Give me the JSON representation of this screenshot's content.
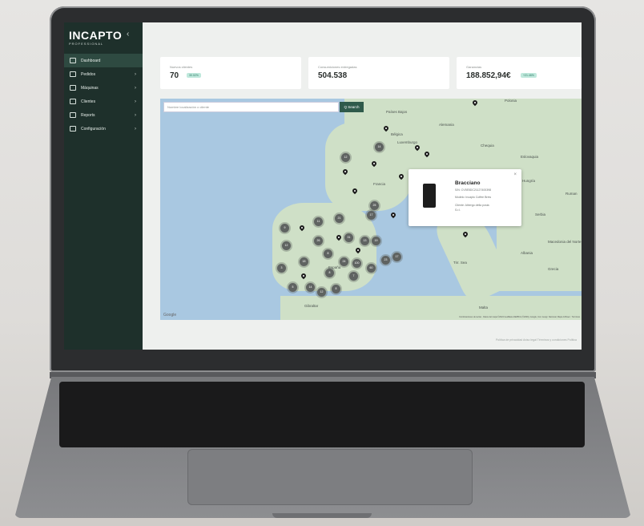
{
  "brand": {
    "name": "INCAPTO",
    "sub": "PROFESSIONAL"
  },
  "sidebar": {
    "collapse_icon": "chevron-left-icon",
    "items": [
      {
        "label": "Dashboard",
        "icon": "dashboard-icon",
        "active": true
      },
      {
        "label": "Pedidos",
        "icon": "bag-icon"
      },
      {
        "label": "Máquinas",
        "icon": "machine-icon"
      },
      {
        "label": "Clientes",
        "icon": "users-icon"
      },
      {
        "label": "Reports",
        "icon": "chart-icon"
      },
      {
        "label": "Configuración",
        "icon": "gear-icon"
      }
    ]
  },
  "stats": [
    {
      "label": "Nuevos clientes",
      "value": "70",
      "badge": "30.02%"
    },
    {
      "label": "Consumiciones entregadas",
      "value": "504.538",
      "badge": ""
    },
    {
      "label": "Ganancias",
      "value": "188.852,94€",
      "badge": "+21.46%"
    }
  ],
  "map": {
    "search_placeholder": "Nombre localización o cliente",
    "search_button": "Q Search",
    "places": [
      "Países Bajos",
      "Bélgica",
      "Alemania",
      "Luxemburgo",
      "Chequia",
      "Eslovaquia",
      "Francia",
      "Hungría",
      "Ruman",
      "Serbia",
      "Macedonia del Norte",
      "Grecia",
      "España",
      "Gibraltar",
      "Malta",
      "Tirr. Sea",
      "Albania",
      "Polonia"
    ],
    "clusters": [
      "12",
      "14",
      "11",
      "21",
      "17",
      "9",
      "26",
      "31",
      "13",
      "12",
      "8",
      "19",
      "18",
      "24",
      "3",
      "100",
      "8",
      "60",
      "7",
      "23",
      "17",
      "14",
      "8",
      "5",
      "12",
      "25"
    ],
    "attribution": "Combinaciones de teclas · Datos del mapa ©2024 GeoBasis-DE/BKG (©2009), Google, Inst. Geogr. Nacional, Mapa GISrael · Términos",
    "google": "Google"
  },
  "popup": {
    "title": "Bracciano",
    "sn": "S/N: CV5E5DC21127400398",
    "model": "Modelo: Incapto Coffee Brew",
    "client": "Cliente: Albergo della posta",
    "client2": "S.r.l.",
    "close": "×"
  },
  "footer": "Política de privacidad  Aviso legal  Términos y condiciones  Política"
}
